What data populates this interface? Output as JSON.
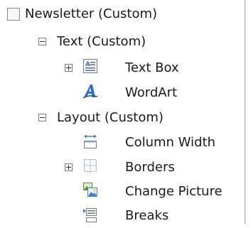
{
  "tree": {
    "root": {
      "label": "Newsletter (Custom)"
    },
    "text_group": {
      "label": "Text (Custom)"
    },
    "text_box": {
      "label": "Text Box",
      "icon": "textbox-icon"
    },
    "wordart": {
      "label": "WordArt",
      "icon": "wordart-icon"
    },
    "layout_group": {
      "label": "Layout (Custom)"
    },
    "column_width": {
      "label": "Column Width",
      "icon": "column-width-icon"
    },
    "borders": {
      "label": "Borders",
      "icon": "borders-icon"
    },
    "change_picture": {
      "label": "Change Picture",
      "icon": "change-picture-icon"
    },
    "breaks": {
      "label": "Breaks",
      "icon": "breaks-icon"
    }
  },
  "colors": {
    "wordart_blue": "#2f6fd0",
    "icon_blue": "#3c7fd6",
    "border_gray": "#8a8a8a"
  }
}
